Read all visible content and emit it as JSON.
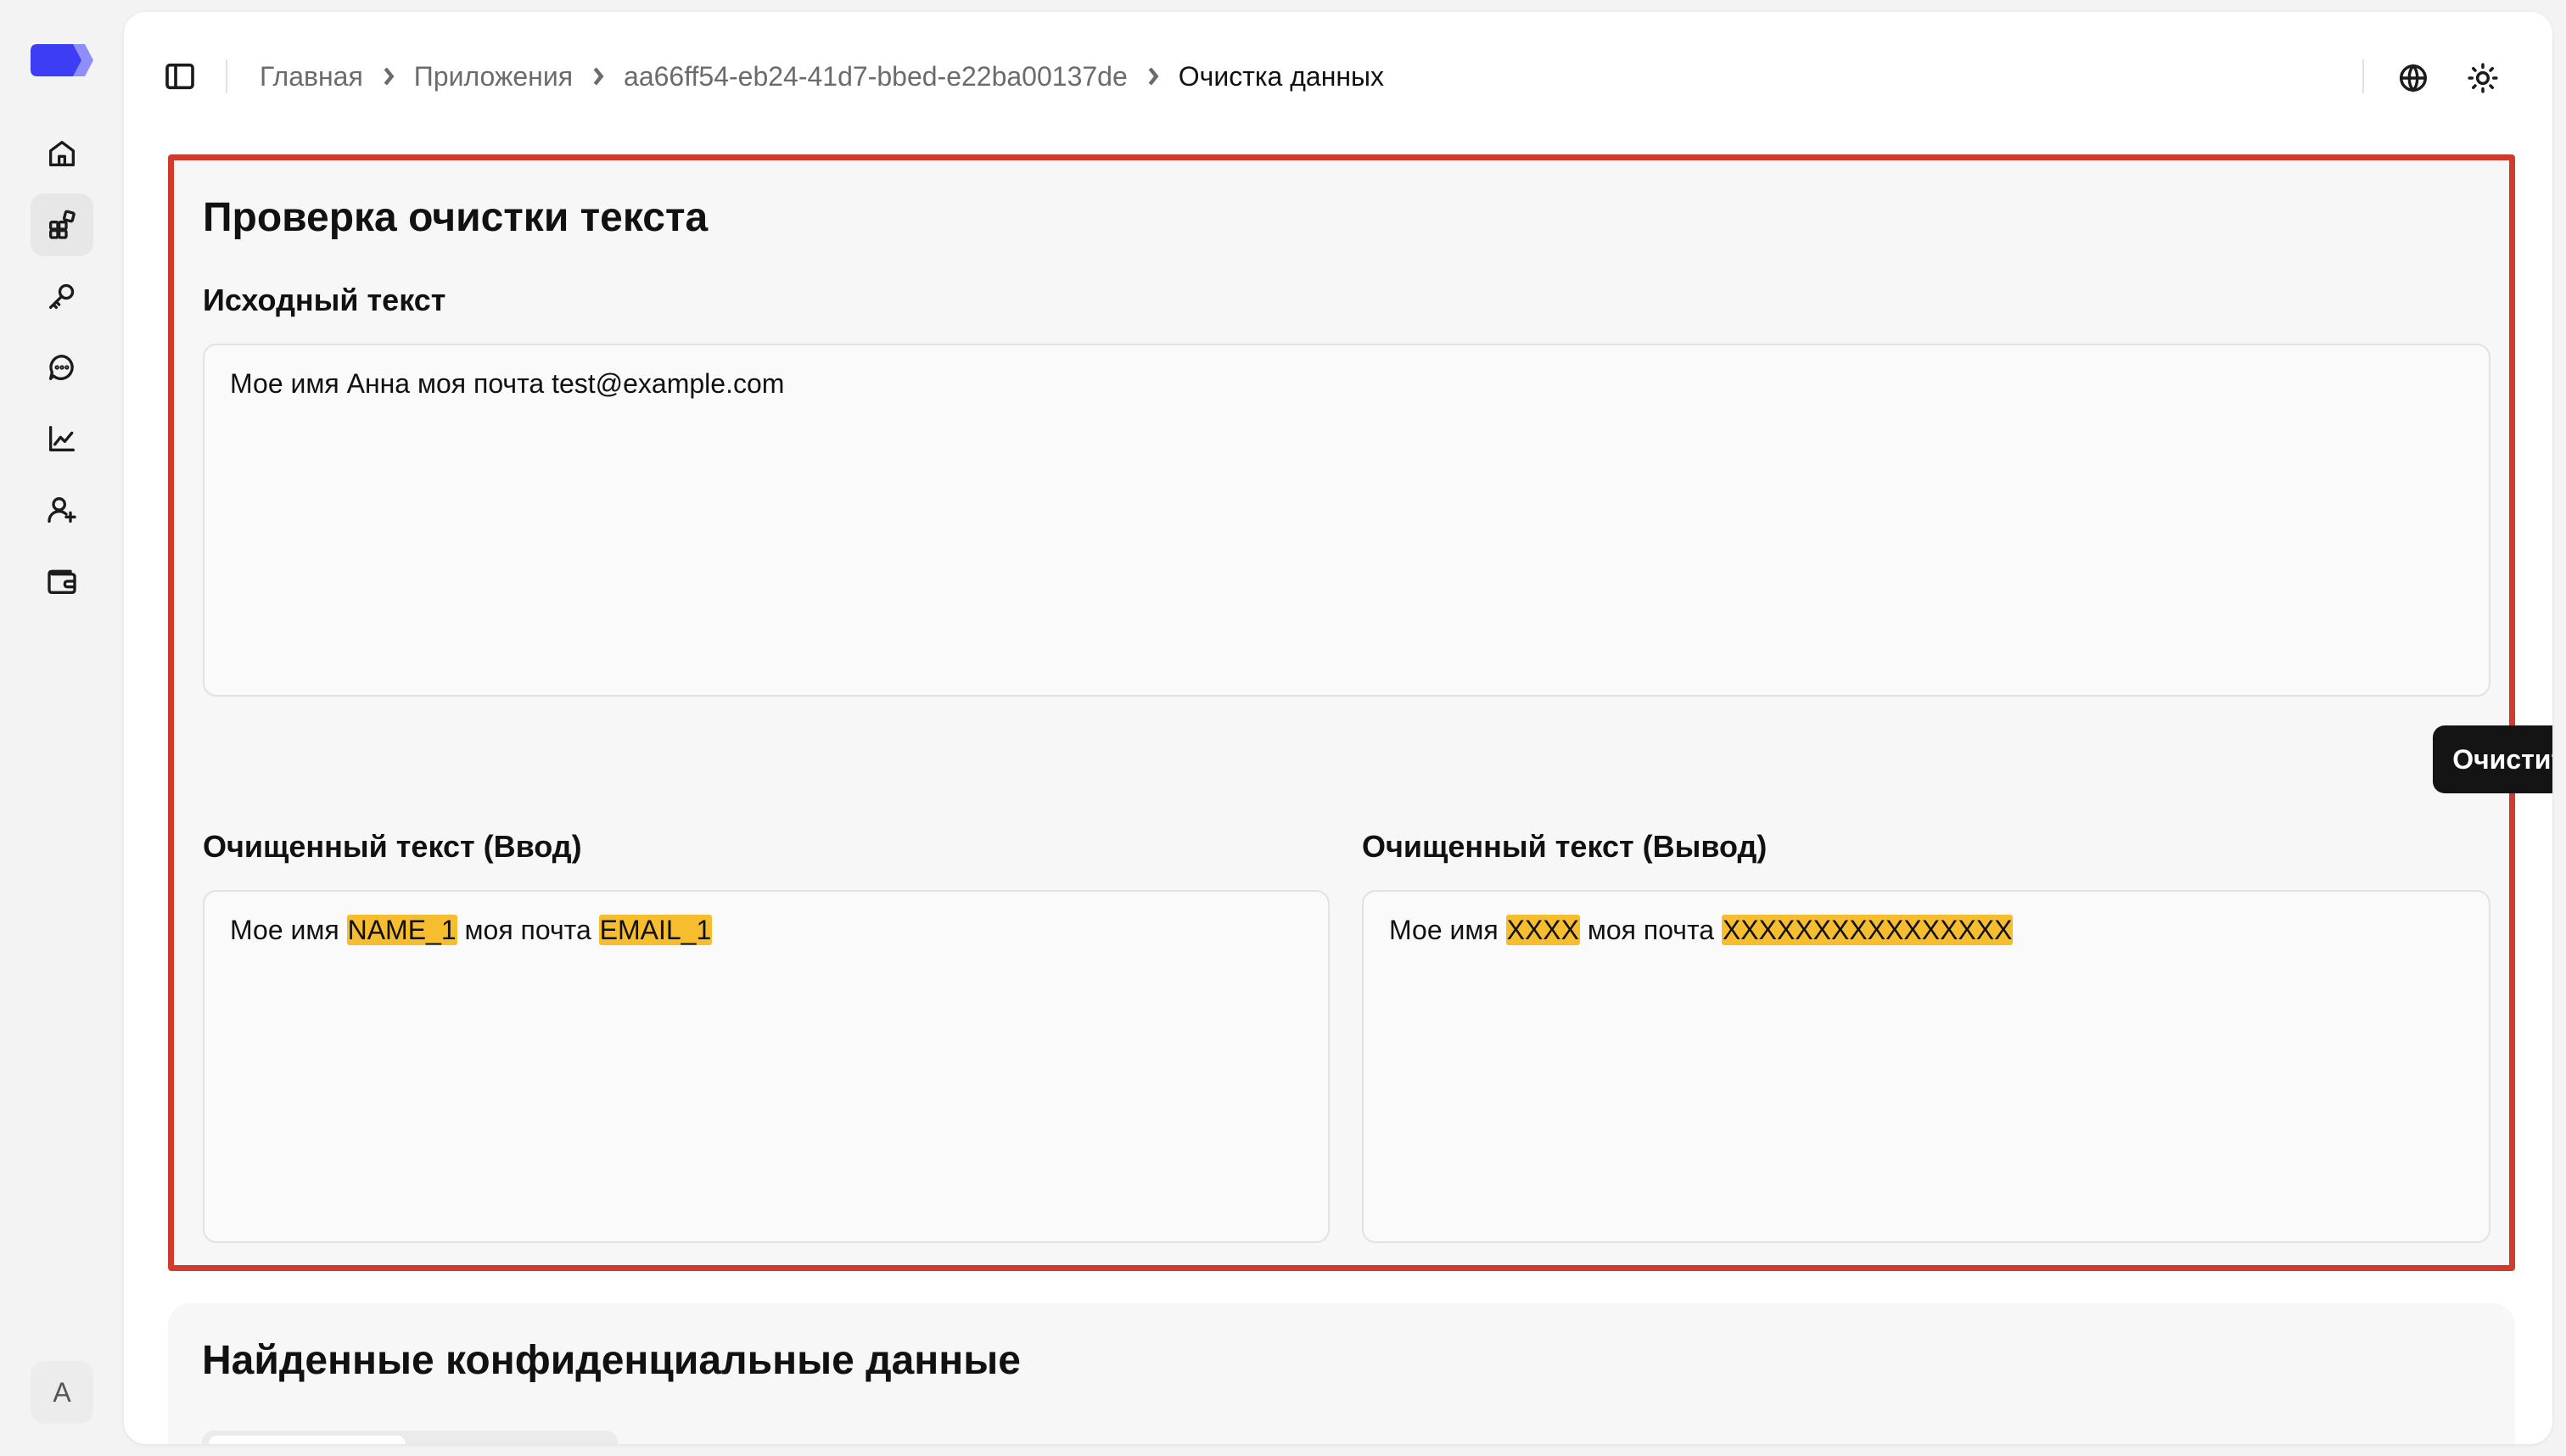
{
  "header": {
    "breadcrumb": [
      "Главная",
      "Приложения",
      "aa66ff54-eb24-41d7-bbed-e22ba00137de"
    ],
    "current": "Очистка данных"
  },
  "sidebar": {
    "items": [
      {
        "name": "home",
        "icon": "home-icon"
      },
      {
        "name": "apps",
        "icon": "apps-icon",
        "active": true
      },
      {
        "name": "keys",
        "icon": "key-icon"
      },
      {
        "name": "chat",
        "icon": "chat-icon"
      },
      {
        "name": "analytics",
        "icon": "chart-icon"
      },
      {
        "name": "users",
        "icon": "user-add-icon"
      },
      {
        "name": "wallet",
        "icon": "wallet-icon"
      }
    ],
    "avatar": "A"
  },
  "test": {
    "title": "Проверка очистки текста",
    "source_label": "Исходный текст",
    "source_text": "Мое имя Анна моя почта test@example.com",
    "clean_button": "Очистить",
    "input_label": "Очищенный текст (Ввод)",
    "output_label": "Очищенный текст (Вывод)",
    "input_result": {
      "prefix": "Мое имя ",
      "token1": "NAME_1",
      "middle": " моя почта ",
      "token2": "EMAIL_1"
    },
    "output_result": {
      "prefix": "Мое имя ",
      "token1": "XXXX",
      "middle": " моя почта ",
      "token2": "XXXXXXXXXXXXXXXX"
    }
  },
  "found": {
    "title": "Найденные конфиденциальные данные"
  },
  "colors": {
    "highlight": "#f6bd2f",
    "panel_border": "#d23b2b",
    "button_bg": "#141414",
    "logo": "#3d3df5"
  }
}
